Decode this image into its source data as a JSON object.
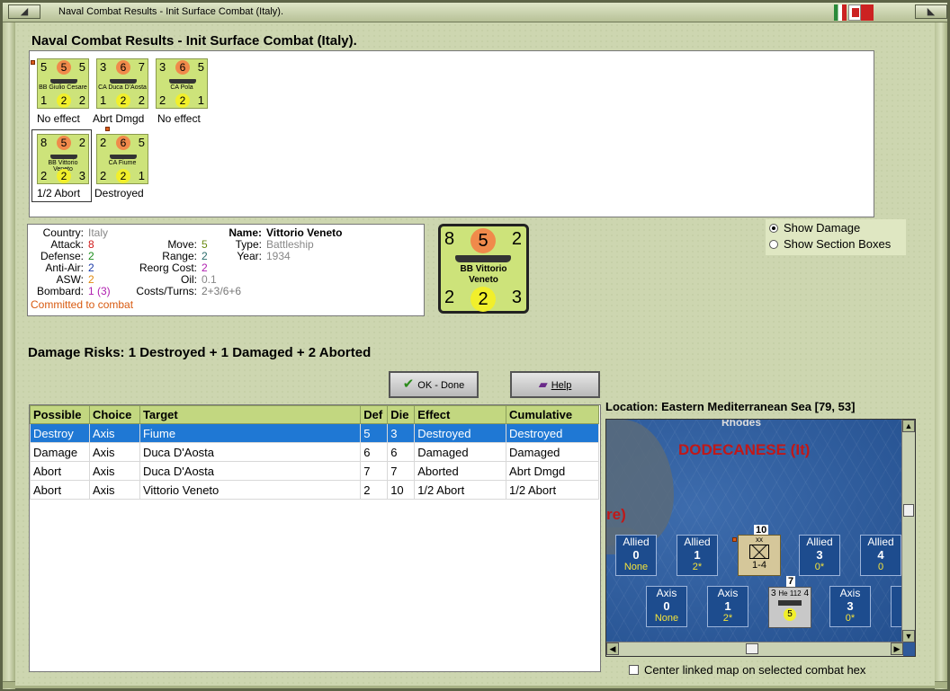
{
  "window": {
    "title": "Naval Combat Results - Init Surface Combat (Italy)."
  },
  "heading": "Naval Combat Results - Init Surface Combat (Italy).",
  "counters": [
    {
      "attack": "5",
      "defense": "5",
      "move": "5",
      "aa": "1",
      "asw": "2",
      "range": "2",
      "name": "BB Giulio Cesare",
      "result": "No effect"
    },
    {
      "attack": "3",
      "defense": "6",
      "move": "7",
      "aa": "1",
      "asw": "2",
      "range": "2",
      "name": "CA Duca D'Aosta",
      "result": "Abrt Dmgd"
    },
    {
      "attack": "3",
      "defense": "6",
      "move": "5",
      "aa": "2",
      "asw": "2",
      "range": "1",
      "name": "CA Pola",
      "result": "No effect"
    },
    {
      "attack": "8",
      "defense": "5",
      "move": "2",
      "aa": "2",
      "asw": "2",
      "range": "3",
      "name": "BB Vittorio Veneto",
      "result": "1/2 Abort"
    },
    {
      "attack": "2",
      "defense": "6",
      "move": "5",
      "aa": "2",
      "asw": "2",
      "range": "1",
      "name": "CA Fiume",
      "result": "Destroyed"
    }
  ],
  "info": {
    "country_label": "Country:",
    "country": "Italy",
    "attack_label": "Attack:",
    "attack": "8",
    "defense_label": "Defense:",
    "defense": "2",
    "antiair_label": "Anti-Air:",
    "antiair": "2",
    "asw_label": "ASW:",
    "asw": "2",
    "bombard_label": "Bombard:",
    "bombard": "1 (3)",
    "move_label": "Move:",
    "move": "5",
    "range_label": "Range:",
    "range": "2",
    "reorg_label": "Reorg Cost:",
    "reorg": "2",
    "oil_label": "Oil:",
    "oil": "0.1",
    "costs_label": "Costs/Turns:",
    "costs": "2+3/6+6",
    "name_label": "Name:",
    "name": "Vittorio Veneto",
    "type_label": "Type:",
    "type": "Battleship",
    "year_label": "Year:",
    "year": "1934",
    "status": "Committed to combat"
  },
  "big_counter": {
    "attack": "8",
    "defense": "5",
    "move": "2",
    "aa": "2",
    "asw": "2",
    "range": "3",
    "name1": "BB Vittorio",
    "name2": "Veneto"
  },
  "options": {
    "show_damage": "Show Damage",
    "show_section_boxes": "Show Section Boxes"
  },
  "damage_risks": "Damage Risks:  1 Destroyed + 1 Damaged + 2 Aborted",
  "buttons": {
    "ok": "OK - Done",
    "help": "Help"
  },
  "table": {
    "headers": [
      "Possible",
      "Choice",
      "Target",
      "Def",
      "Die",
      "Effect",
      "Cumulative"
    ],
    "rows": [
      [
        "Destroy",
        "Axis",
        "Fiume",
        "5",
        "3",
        "Destroyed",
        "Destroyed"
      ],
      [
        "Damage",
        "Axis",
        "Duca D'Aosta",
        "6",
        "6",
        "Damaged",
        "Damaged"
      ],
      [
        "Abort",
        "Axis",
        "Duca D'Aosta",
        "7",
        "7",
        "Aborted",
        "Abrt Dmgd"
      ],
      [
        "Abort",
        "Axis",
        "Vittorio Veneto",
        "2",
        "10",
        "1/2 Abort",
        "1/2 Abort"
      ]
    ]
  },
  "location": "Location:  Eastern Mediterranean Sea [79, 53]",
  "map": {
    "region": "DODECANESE (It)",
    "partial_label": "re)",
    "top_label": "Rhodes",
    "allied_slots": [
      {
        "label": "Allied",
        "num": "0",
        "sub": "None"
      },
      {
        "label": "Allied",
        "num": "1",
        "sub": "2*"
      },
      {
        "label": "Allied",
        "num": "3",
        "sub": "0*"
      },
      {
        "label": "Allied",
        "num": "4",
        "sub": "0"
      }
    ],
    "axis_slots": [
      {
        "label": "Axis",
        "num": "0",
        "sub": "None"
      },
      {
        "label": "Axis",
        "num": "1",
        "sub": "2*"
      },
      {
        "label": "Axis",
        "num": "3",
        "sub": "0*"
      }
    ],
    "unit_inf": {
      "stack": "10",
      "size": "xx",
      "value": "1-4",
      "side": "2nd Inf Div"
    },
    "unit_air": {
      "stack": "7",
      "name": "He 112",
      "left": "3",
      "right": "4",
      "bottom": "5"
    }
  },
  "center_linked": "Center linked map on selected combat hex"
}
